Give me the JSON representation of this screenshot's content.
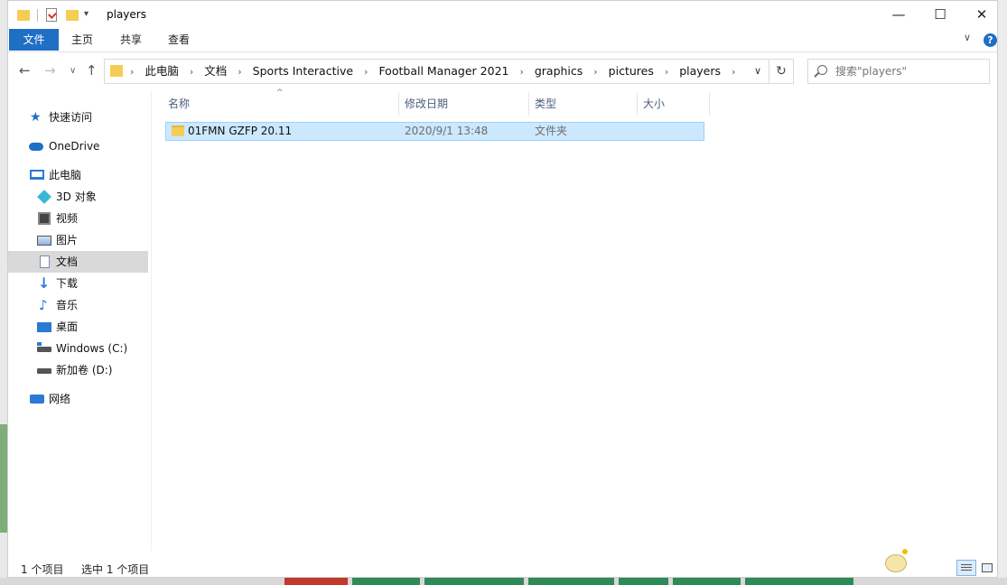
{
  "window": {
    "title": "players"
  },
  "title_bar": {
    "quick_access": [
      "folder-icon",
      "properties-icon",
      "new-folder-icon",
      "customize-dropdown-icon"
    ],
    "controls": {
      "minimize": "—",
      "maximize": "☐",
      "close": "✕"
    }
  },
  "ribbon": {
    "tabs": [
      {
        "label": "文件",
        "active": true
      },
      {
        "label": "主页"
      },
      {
        "label": "共享"
      },
      {
        "label": "查看"
      }
    ],
    "help": "?"
  },
  "address_bar": {
    "breadcrumbs": [
      "此电脑",
      "文档",
      "Sports Interactive",
      "Football Manager 2021",
      "graphics",
      "pictures",
      "players"
    ],
    "separator": "›"
  },
  "search": {
    "placeholder": "搜索\"players\"",
    "value": ""
  },
  "nav_pane": {
    "items": [
      {
        "label": "快速访问",
        "icon": "star-icon"
      },
      {
        "label": "OneDrive",
        "icon": "cloud-icon"
      },
      {
        "label": "此电脑",
        "icon": "computer-icon"
      },
      {
        "label": "3D 对象",
        "icon": "cube-icon"
      },
      {
        "label": "视频",
        "icon": "video-icon"
      },
      {
        "label": "图片",
        "icon": "picture-icon"
      },
      {
        "label": "文档",
        "icon": "document-icon",
        "selected": true
      },
      {
        "label": "下载",
        "icon": "download-icon"
      },
      {
        "label": "音乐",
        "icon": "music-icon"
      },
      {
        "label": "桌面",
        "icon": "desktop-icon"
      },
      {
        "label": "Windows (C:)",
        "icon": "drive-icon"
      },
      {
        "label": "新加卷 (D:)",
        "icon": "drive-icon"
      },
      {
        "label": "网络",
        "icon": "network-icon"
      }
    ]
  },
  "file_list": {
    "columns": [
      "名称",
      "修改日期",
      "类型",
      "大小"
    ],
    "rows": [
      {
        "name": "01FMN GZFP 20.11",
        "modified": "2020/9/1 13:48",
        "type": "文件夹",
        "size": ""
      }
    ]
  },
  "status_bar": {
    "item_count": "1 个项目",
    "selected": "选中 1 个项目"
  },
  "colors": {
    "accent": "#1f6fc5",
    "selection_bg": "#cce8ff",
    "selection_border": "#99d1ff",
    "folder": "#f6cc55"
  }
}
